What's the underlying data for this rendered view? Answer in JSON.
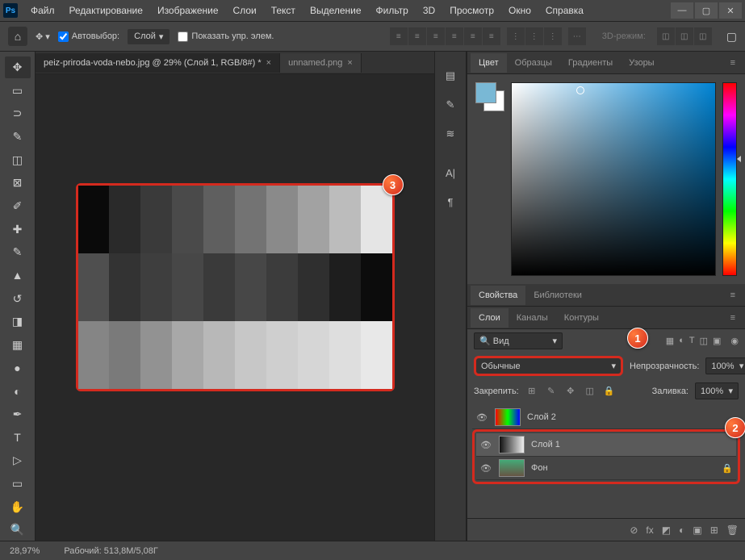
{
  "menu": {
    "file": "Файл",
    "edit": "Редактирование",
    "image": "Изображение",
    "layer": "Слои",
    "text": "Текст",
    "select": "Выделение",
    "filter": "Фильтр",
    "threeD": "3D",
    "view": "Просмотр",
    "window": "Окно",
    "help": "Справка"
  },
  "optbar": {
    "autoselect": "Автовыбор:",
    "layer_opt": "Слой",
    "show_controls": "Показать упр. элем.",
    "mode3d": "3D-режим:"
  },
  "tabs": {
    "t1": "peiz-priroda-voda-nebo.jpg @ 29% (Слой 1, RGB/8#) *",
    "t2": "unnamed.png"
  },
  "color_panel": {
    "tab_color": "Цвет",
    "tab_swatches": "Образцы",
    "tab_gradients": "Градиенты",
    "tab_patterns": "Узоры"
  },
  "props_panel": {
    "tab_props": "Свойства",
    "tab_libs": "Библиотеки"
  },
  "layers": {
    "tab_layers": "Слои",
    "tab_channels": "Каналы",
    "tab_paths": "Контуры",
    "kind": "Вид",
    "blend": "Обычные",
    "opacity_lbl": "Непрозрачность:",
    "opacity_val": "100%",
    "lock_lbl": "Закрепить:",
    "fill_lbl": "Заливка:",
    "fill_val": "100%",
    "items": [
      {
        "name": "Слой 2"
      },
      {
        "name": "Слой 1"
      },
      {
        "name": "Фон"
      }
    ]
  },
  "status": {
    "zoom": "28,97%",
    "doc": "Рабочий: 513,8M/5,08Г"
  },
  "badges": {
    "b1": "1",
    "b2": "2",
    "b3": "3"
  }
}
